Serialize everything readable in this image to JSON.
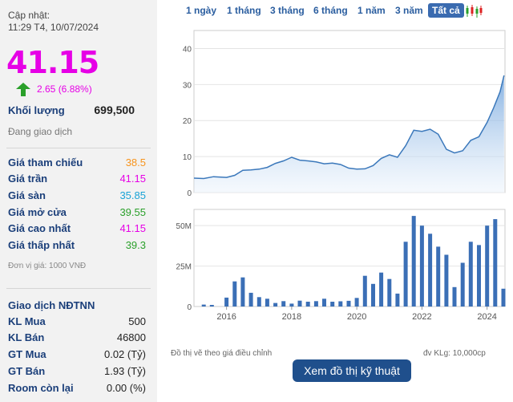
{
  "header": {
    "update_label": "Cập nhật:",
    "update_time": "11:29 T4, 10/07/2024"
  },
  "quote": {
    "price": "41.15",
    "change": "2.65 (6.88%)",
    "volume_label": "Khối lượng",
    "volume_value": "699,500",
    "status": "Đang giao dịch"
  },
  "price_rows": [
    {
      "label": "Giá tham chiếu",
      "value": "38.5",
      "color": "#f7941d"
    },
    {
      "label": "Giá trần",
      "value": "41.15",
      "color": "#e600e6"
    },
    {
      "label": "Giá sàn",
      "value": "35.85",
      "color": "#1aa3d6"
    },
    {
      "label": "Giá mở cửa",
      "value": "39.55",
      "color": "#2aa02a"
    },
    {
      "label": "Giá cao nhất",
      "value": "41.15",
      "color": "#e600e6"
    },
    {
      "label": "Giá thấp nhất",
      "value": "39.3",
      "color": "#2aa02a"
    }
  ],
  "unit_note": "Đơn vị giá: 1000 VNĐ",
  "foreign": {
    "title": "Giao dịch NĐTNN",
    "rows": [
      {
        "label": "KL Mua",
        "value": "500"
      },
      {
        "label": "KL Bán",
        "value": "46800"
      },
      {
        "label": "GT Mua",
        "value": "0.02 (Tỷ)"
      },
      {
        "label": "GT Bán",
        "value": "1.93 (Tỷ)"
      },
      {
        "label": "Room còn lại",
        "value": "0.00 (%)"
      }
    ]
  },
  "tabs": [
    "1 ngày",
    "1 tháng",
    "3 tháng",
    "6 tháng",
    "1 năm",
    "3 năm",
    "Tất cả"
  ],
  "active_tab": "Tất cả",
  "icons": {
    "arrow": "arrow-up-icon",
    "candles": "candlestick-icon"
  },
  "colors": {
    "up": "#2aa02a",
    "ceiling": "#e600e6",
    "line": "#4a86c5",
    "bar": "#3b6fb6"
  },
  "chart_data": [
    {
      "type": "area",
      "title": "",
      "yticks": [
        0,
        10,
        20,
        30,
        40
      ],
      "ylim": [
        0,
        45
      ],
      "xlim": [
        2015.0,
        2024.55
      ],
      "x": [
        2015.0,
        2015.3,
        2015.6,
        2016.0,
        2016.25,
        2016.5,
        2016.75,
        2017.0,
        2017.25,
        2017.5,
        2017.75,
        2018.0,
        2018.25,
        2018.5,
        2018.75,
        2019.0,
        2019.25,
        2019.5,
        2019.75,
        2020.0,
        2020.25,
        2020.5,
        2020.75,
        2021.0,
        2021.25,
        2021.5,
        2021.75,
        2022.0,
        2022.25,
        2022.5,
        2022.75,
        2023.0,
        2023.25,
        2023.5,
        2023.75,
        2024.0,
        2024.2,
        2024.4,
        2024.52
      ],
      "y": [
        4.0,
        3.9,
        4.4,
        4.2,
        4.8,
        6.2,
        6.3,
        6.5,
        7.0,
        8.1,
        8.8,
        9.8,
        9.0,
        8.8,
        8.5,
        8.0,
        8.2,
        7.8,
        6.8,
        6.5,
        6.6,
        7.5,
        9.5,
        10.5,
        9.8,
        13.0,
        17.3,
        17.0,
        17.6,
        16.2,
        12.0,
        11.0,
        11.6,
        14.5,
        15.5,
        19.5,
        23.5,
        28.0,
        32.5
      ]
    },
    {
      "type": "bar",
      "title": "",
      "yticks_labels": [
        "0",
        "25M",
        "50M"
      ],
      "ylim": [
        0,
        60
      ],
      "xticks": [
        2016,
        2018,
        2020,
        2022,
        2024
      ],
      "x": [
        2015.3,
        2015.55,
        2016.0,
        2016.25,
        2016.5,
        2016.75,
        2017.0,
        2017.25,
        2017.5,
        2017.75,
        2018.0,
        2018.25,
        2018.5,
        2018.75,
        2019.0,
        2019.25,
        2019.5,
        2019.75,
        2020.0,
        2020.25,
        2020.5,
        2020.75,
        2021.0,
        2021.25,
        2021.5,
        2021.75,
        2022.0,
        2022.25,
        2022.5,
        2022.75,
        2023.0,
        2023.25,
        2023.5,
        2023.75,
        2024.0,
        2024.25,
        2024.5
      ],
      "values": [
        1.2,
        1.0,
        5.5,
        15.5,
        18.0,
        8.5,
        5.8,
        4.8,
        2.2,
        3.3,
        1.8,
        3.6,
        3.0,
        3.3,
        4.8,
        3.0,
        3.2,
        3.5,
        5.3,
        19.0,
        14.0,
        21.0,
        17.0,
        8.0,
        40.0,
        56.0,
        50.0,
        45.0,
        37.0,
        32.0,
        12.0,
        27.0,
        40.0,
        38.0,
        50.0,
        54.0,
        11.0
      ]
    }
  ],
  "notes": {
    "left": "Đồ thị vẽ theo giá điều chỉnh",
    "right": "đv KLg: 10,000cp",
    "button": "Xem đồ thị kỹ thuật"
  }
}
